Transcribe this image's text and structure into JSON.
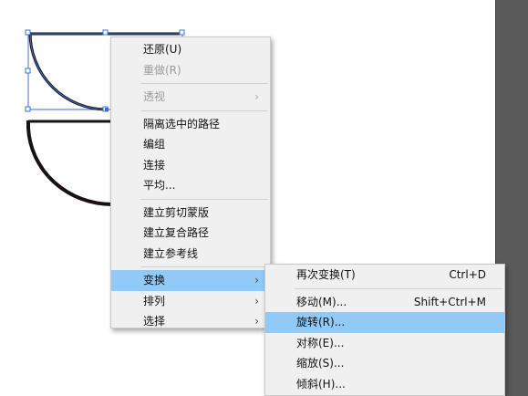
{
  "colors": {
    "canvas": "#ffffff",
    "artboard_edge": "#5a5a5a",
    "menu_bg": "#f0f0f0",
    "highlight": "#91c9f7",
    "selection": "#3a6fd8",
    "shape_stroke": "#1a1212"
  },
  "context_menu": {
    "items": [
      {
        "label": "还原(U)",
        "enabled": true
      },
      {
        "label": "重做(R)",
        "enabled": false
      },
      {
        "label": "透视",
        "enabled": false,
        "submenu": true
      },
      {
        "label": "隔离选中的路径",
        "enabled": true
      },
      {
        "label": "编组",
        "enabled": true
      },
      {
        "label": "连接",
        "enabled": true
      },
      {
        "label": "平均...",
        "enabled": true
      },
      {
        "label": "建立剪切蒙版",
        "enabled": true
      },
      {
        "label": "建立复合路径",
        "enabled": true
      },
      {
        "label": "建立参考线",
        "enabled": true
      },
      {
        "label": "变换",
        "enabled": true,
        "submenu": true,
        "highlighted": true
      },
      {
        "label": "排列",
        "enabled": true,
        "submenu": true
      },
      {
        "label": "选择",
        "enabled": true,
        "submenu": true
      }
    ],
    "chevron": "›"
  },
  "transform_submenu": {
    "items": [
      {
        "label": "再次变换(T)",
        "shortcut": "Ctrl+D"
      },
      {
        "label": "移动(M)...",
        "shortcut": "Shift+Ctrl+M"
      },
      {
        "label": "旋转(R)...",
        "shortcut": "",
        "highlighted": true
      },
      {
        "label": "对称(E)...",
        "shortcut": ""
      },
      {
        "label": "缩放(S)...",
        "shortcut": ""
      },
      {
        "label": "倾斜(H)...",
        "shortcut": ""
      }
    ]
  }
}
